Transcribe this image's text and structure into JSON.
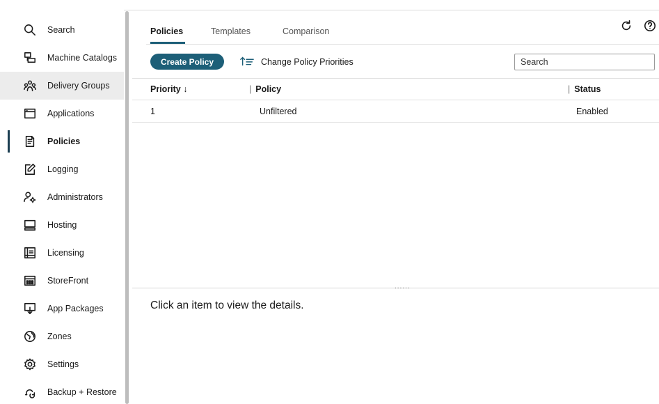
{
  "sidebar": {
    "items": [
      {
        "label": "Search",
        "icon": "search-icon"
      },
      {
        "label": "Machine Catalogs",
        "icon": "machine-catalogs-icon"
      },
      {
        "label": "Delivery Groups",
        "icon": "delivery-groups-icon"
      },
      {
        "label": "Applications",
        "icon": "applications-icon"
      },
      {
        "label": "Policies",
        "icon": "policies-icon"
      },
      {
        "label": "Logging",
        "icon": "logging-icon"
      },
      {
        "label": "Administrators",
        "icon": "administrators-icon"
      },
      {
        "label": "Hosting",
        "icon": "hosting-icon"
      },
      {
        "label": "Licensing",
        "icon": "licensing-icon"
      },
      {
        "label": "StoreFront",
        "icon": "storefront-icon"
      },
      {
        "label": "App Packages",
        "icon": "app-packages-icon"
      },
      {
        "label": "Zones",
        "icon": "zones-icon"
      },
      {
        "label": "Settings",
        "icon": "settings-icon"
      },
      {
        "label": "Backup + Restore",
        "icon": "backup-restore-icon"
      }
    ],
    "active_item": "Policies",
    "hovered_item": "Delivery Groups"
  },
  "tabs": [
    {
      "label": "Policies",
      "active": true
    },
    {
      "label": "Templates",
      "active": false
    },
    {
      "label": "Comparison",
      "active": false
    }
  ],
  "header_icons": [
    "refresh-icon",
    "help-icon"
  ],
  "toolbar": {
    "create_label": "Create Policy",
    "priorities_label": "Change Policy Priorities",
    "search_placeholder": "Search"
  },
  "table": {
    "columns": {
      "priority": "Priority ↓",
      "policy": "Policy",
      "status": "Status"
    },
    "rows": [
      {
        "priority": "1",
        "policy": "Unfiltered",
        "status": "Enabled"
      }
    ]
  },
  "details": {
    "grip": "......",
    "text": "Click an item to view the details."
  },
  "colors": {
    "accent": "#1d5f78",
    "active_indicator": "#1d3f52",
    "hover_bg": "#ececec"
  }
}
